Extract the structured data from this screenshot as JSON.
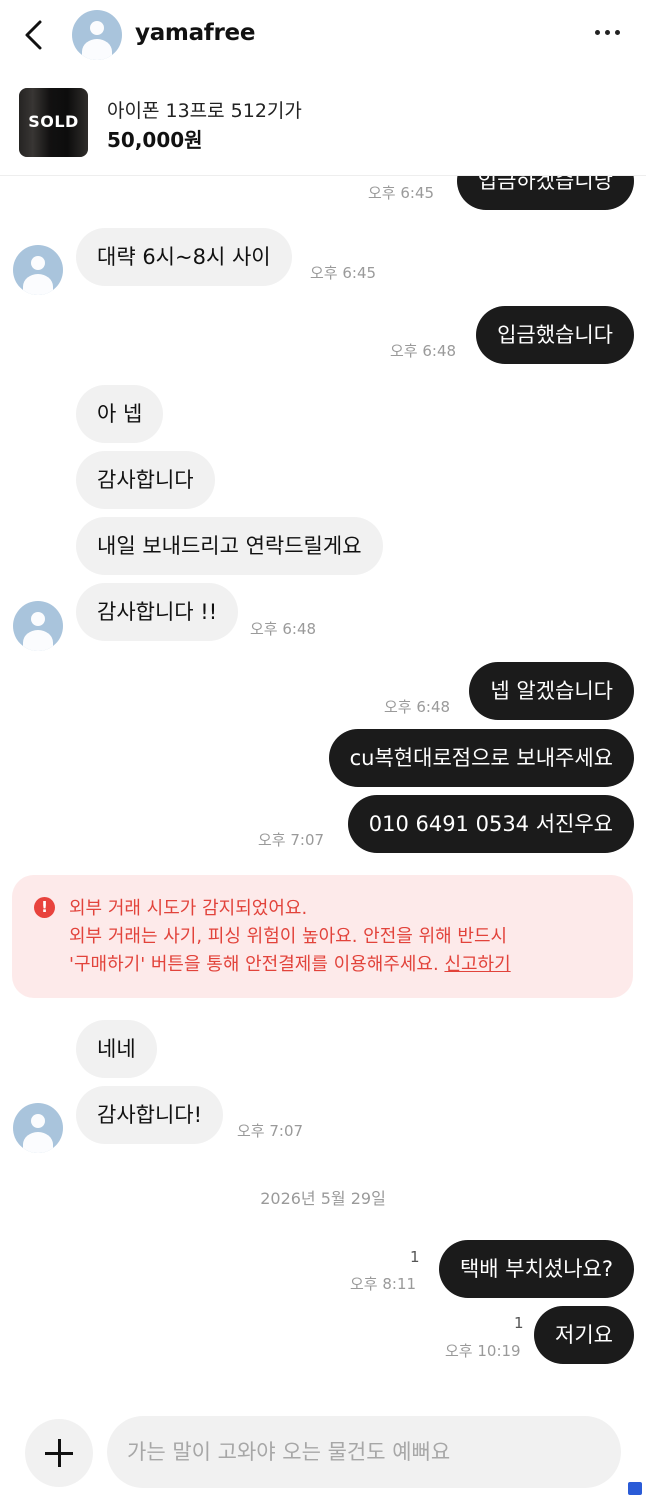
{
  "header": {
    "username": "yamafree"
  },
  "product": {
    "badge": "SOLD",
    "title": "아이폰 13프로 512기가",
    "price": "50,000원"
  },
  "messages": [
    {
      "text": "입금하겠습니당",
      "time": "오후 6:45"
    },
    {
      "text": "대략 6시~8시 사이",
      "time": "오후 6:45"
    },
    {
      "text": "입금했습니다",
      "time": "오후 6:48"
    },
    {
      "text": "아 넵"
    },
    {
      "text": "감사합니다"
    },
    {
      "text": "내일 보내드리고 연락드릴게요"
    },
    {
      "text": "감사합니다 !!",
      "time": "오후 6:48"
    },
    {
      "text": "넵 알겠습니다",
      "time": "오후 6:48"
    },
    {
      "text": "cu복현대로점으로 보내주세요"
    },
    {
      "text": "010 6491 0534 서진우요",
      "time": "오후 7:07"
    },
    {
      "text": "네네"
    },
    {
      "text": "감사합니다!",
      "time": "오후 7:07"
    },
    {
      "text": "택배 부치셨나요?",
      "time": "오후 8:11",
      "unread": "1"
    },
    {
      "text": "저기요",
      "time": "오후 10:19",
      "unread": "1"
    }
  ],
  "warning": {
    "icon": "!",
    "line1": "외부 거래 시도가 감지되었어요.",
    "line2": "외부 거래는 사기, 피싱 위험이 높아요. 안전을 위해 반드시",
    "line3": "'구매하기' 버튼을 통해 안전결제를 이용해주세요.",
    "report": "신고하기"
  },
  "date_divider": "2026년 5월 29일",
  "composer": {
    "placeholder": "가는 말이 고와야 오는 물건도 예뻐요"
  },
  "colors": {
    "outgoing_bubble": "#1b1b1b",
    "incoming_bubble": "#f1f1f1",
    "warning_bg": "#fdeaea",
    "warning_text": "#e2433b",
    "avatar": "#a9c4dc"
  }
}
